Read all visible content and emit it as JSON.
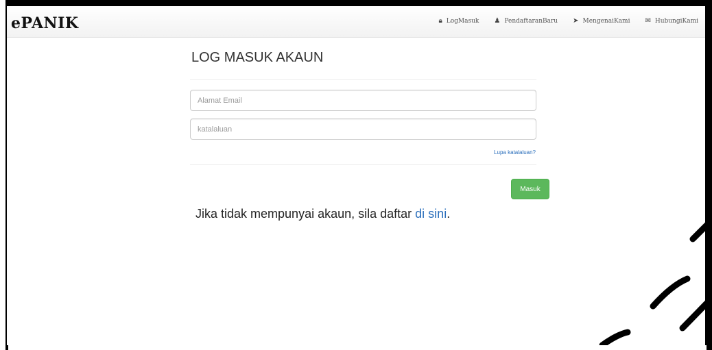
{
  "navbar": {
    "brand": "ePANIK",
    "links": [
      {
        "label": "LogMasuk",
        "icon": "lock-icon"
      },
      {
        "label": "PendaftaranBaru",
        "icon": "user-icon"
      },
      {
        "label": "MengenaiKami",
        "icon": "tag-icon"
      },
      {
        "label": "HubungiKami",
        "icon": "envelope-icon"
      }
    ]
  },
  "login": {
    "title": "LOG MASUK AKAUN",
    "email_placeholder": "Alamat Email",
    "password_placeholder": "katalaluan",
    "forgot_label": "Lupa katalaluan?",
    "submit_label": "Masuk"
  },
  "signup": {
    "text": "Jika tidak mempunyai akaun, sila daftar ",
    "link_label": "di sini",
    "suffix": "."
  },
  "colors": {
    "accent_green": "#5cb85c",
    "link_blue": "#2a6ebb"
  }
}
